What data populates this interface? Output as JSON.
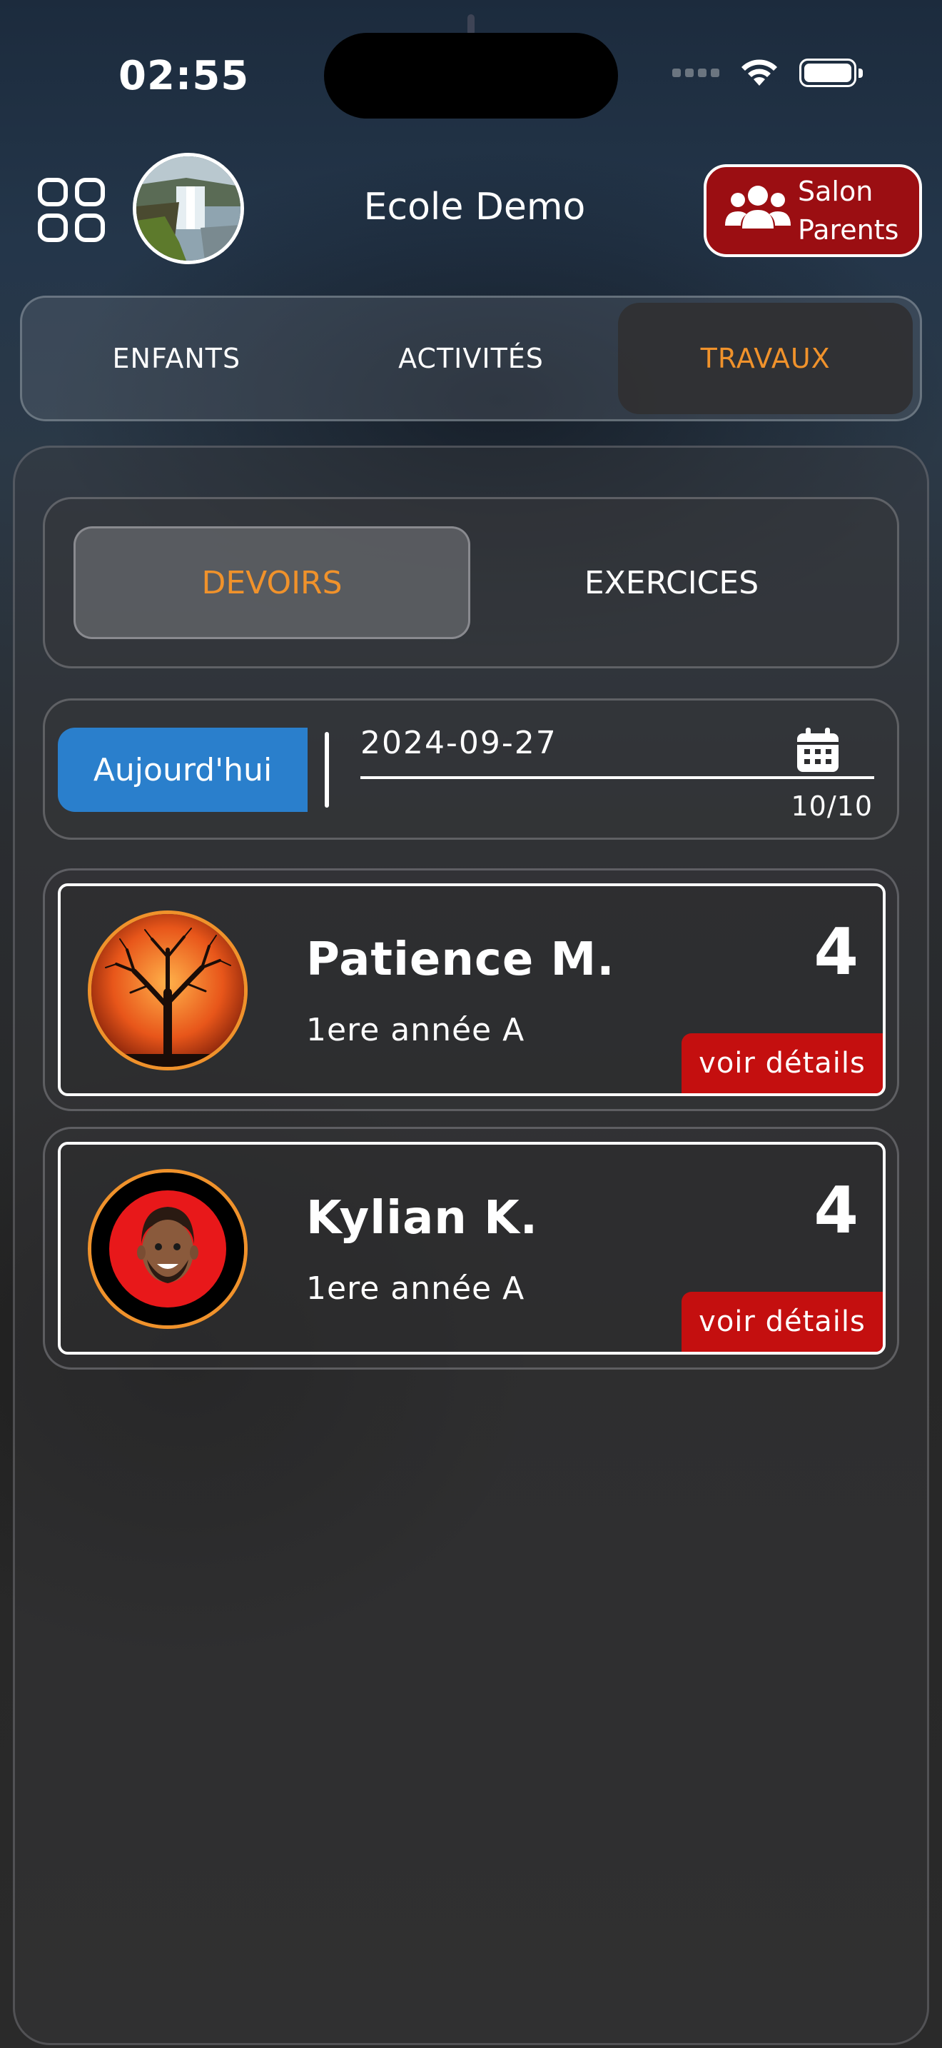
{
  "status_bar": {
    "time": "02:55"
  },
  "header": {
    "school_name": "Ecole Demo",
    "salon_line1": "Salon",
    "salon_line2": "Parents"
  },
  "main_tabs": [
    {
      "label": "ENFANTS",
      "active": false
    },
    {
      "label": "ACTIVITÉS",
      "active": false
    },
    {
      "label": "TRAVAUX",
      "active": true
    }
  ],
  "sub_tabs": [
    {
      "label": "DEVOIRS",
      "active": true
    },
    {
      "label": "EXERCICES",
      "active": false
    }
  ],
  "date_filter": {
    "today_label": "Aujourd'hui",
    "date": "2024-09-27",
    "count": "10/10"
  },
  "children": [
    {
      "name": "Patience M.",
      "class": "1ere année A",
      "count": "4",
      "details_label": "voir détails",
      "avatar_icon": "tree-icon"
    },
    {
      "name": "Kylian K.",
      "class": "1ere année A",
      "count": "4",
      "details_label": "voir détails",
      "avatar_icon": "memoji-icon"
    }
  ],
  "colors": {
    "accent_orange": "#f0922b",
    "salon_red": "#9b0e12",
    "details_red": "#c40f0f",
    "today_blue": "#2a7fcc"
  }
}
